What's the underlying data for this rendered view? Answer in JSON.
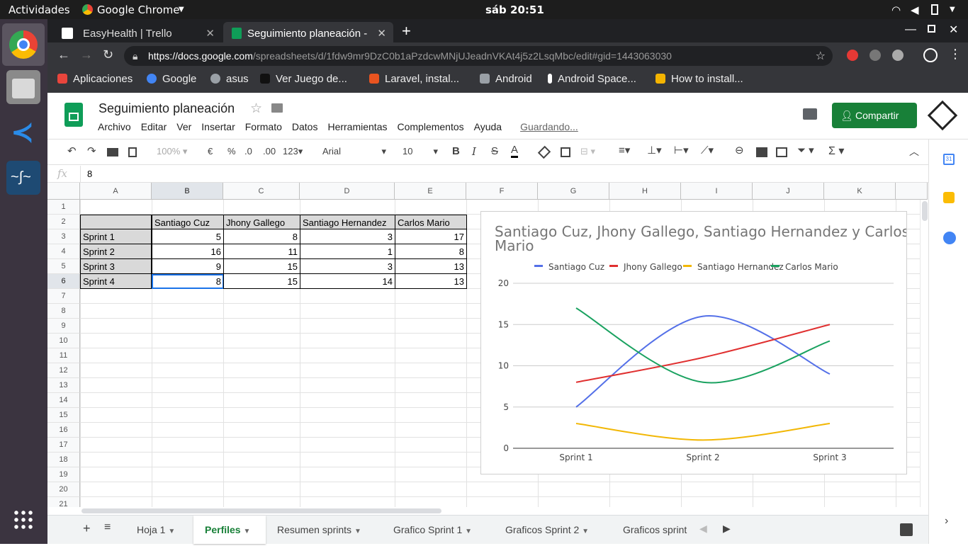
{
  "system": {
    "activities": "Actividades",
    "app_name": "Google Chrome",
    "clock": "sáb 20:51"
  },
  "browser": {
    "tabs": [
      {
        "title": "EasyHealth | Trello",
        "active": false
      },
      {
        "title": "Seguimiento planeación -",
        "active": true
      }
    ],
    "url_host": "https://docs.google.com",
    "url_path": "/spreadsheets/d/1fdw9mr9DzC0b1aPzdcwMNjUJeadnVKAt4j5z2LsqMbc/edit#gid=1443063030",
    "bookmarks": [
      {
        "label": "Aplicaciones",
        "color": "#e8453c"
      },
      {
        "label": "Google",
        "color": "#4285f4"
      },
      {
        "label": "asus",
        "color": "#9aa0a6"
      },
      {
        "label": "Ver Juego de...",
        "color": "#222222"
      },
      {
        "label": "Laravel, instal...",
        "color": "#e95420"
      },
      {
        "label": "Android",
        "color": "#9aa0a6"
      },
      {
        "label": "Android Space...",
        "color": "#ffffff"
      },
      {
        "label": "How to install...",
        "color": "#f4b400"
      }
    ]
  },
  "doc": {
    "title": "Seguimiento planeación",
    "share_label": "Compartir",
    "saving": "Guardando...",
    "menu": [
      "Archivo",
      "Editar",
      "Ver",
      "Insertar",
      "Formato",
      "Datos",
      "Herramientas",
      "Complementos",
      "Ayuda"
    ]
  },
  "toolbar": {
    "zoom": "100%",
    "currency": "€",
    "percent": "%",
    "dec_less": ".0",
    "dec_more": ".00",
    "format_more": "123",
    "font": "Arial",
    "size": "10"
  },
  "formula": {
    "fx": "fx",
    "value": "8"
  },
  "grid": {
    "columns": [
      "A",
      "B",
      "C",
      "D",
      "E",
      "F",
      "G",
      "H",
      "I",
      "J",
      "K"
    ],
    "rows": [
      "1",
      "2",
      "3",
      "4",
      "5",
      "6",
      "7",
      "8",
      "9",
      "10",
      "11",
      "12",
      "13",
      "14",
      "15",
      "16",
      "17",
      "18",
      "19",
      "20",
      "21"
    ],
    "headers": [
      "Santiago Cuz",
      "Jhony Gallego",
      "Santiago Hernandez",
      "Carlos Mario"
    ],
    "data": [
      {
        "label": "Sprint 1",
        "values": [
          "5",
          "8",
          "3",
          "17"
        ]
      },
      {
        "label": "Sprint 2",
        "values": [
          "16",
          "11",
          "1",
          "8"
        ]
      },
      {
        "label": "Sprint 3",
        "values": [
          "9",
          "15",
          "3",
          "13"
        ]
      },
      {
        "label": "Sprint 4",
        "values": [
          "8",
          "15",
          "14",
          "13"
        ]
      }
    ]
  },
  "chart_data": {
    "type": "line",
    "title": "Santiago Cuz, Jhony Gallego, Santiago Hernandez y Carlos Mario",
    "categories": [
      "Sprint 1",
      "Sprint 2",
      "Sprint 3"
    ],
    "series": [
      {
        "name": "Santiago Cuz",
        "values": [
          5,
          16,
          9
        ],
        "color": "#5470e8"
      },
      {
        "name": "Jhony Gallego",
        "values": [
          8,
          11,
          15
        ],
        "color": "#e03030"
      },
      {
        "name": "Santiago Hernandez",
        "values": [
          3,
          1,
          3
        ],
        "color": "#f2b705"
      },
      {
        "name": "Carlos Mario",
        "values": [
          17,
          8,
          13
        ],
        "color": "#1aa260"
      }
    ],
    "yticks": [
      "0",
      "5",
      "10",
      "15",
      "20"
    ],
    "ylim": [
      0,
      20
    ],
    "grid": true,
    "legend": "top",
    "smooth": true
  },
  "sheet_tabs": [
    "Hoja 1",
    "Perfiles",
    "Resumen sprints",
    "Grafico Sprint 1",
    "Graficos Sprint 2",
    "Graficos sprint"
  ],
  "active_sheet": "Perfiles",
  "colors": {
    "accent": "#188038",
    "selection": "#1a73e8"
  }
}
